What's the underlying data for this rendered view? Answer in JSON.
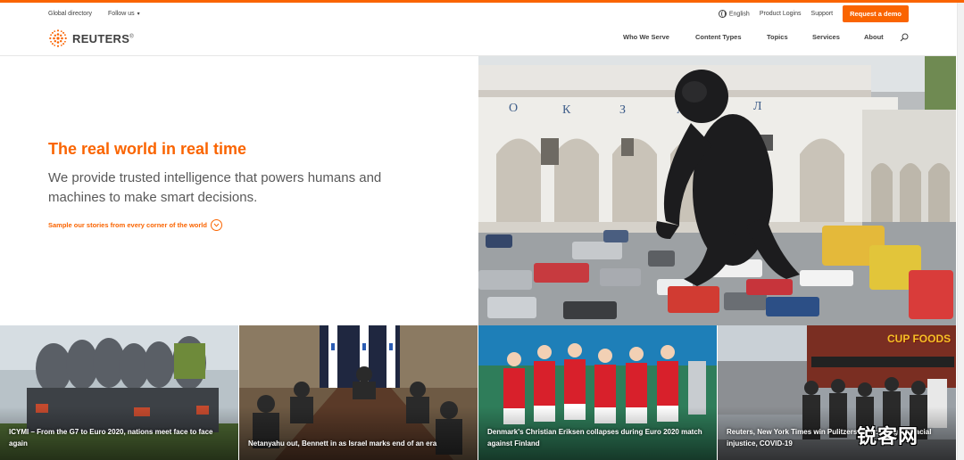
{
  "utility_nav": {
    "global_directory": "Global directory",
    "follow_us": "Follow us",
    "language": "English",
    "product_logins": "Product Logins",
    "support": "Support",
    "request_demo": "Request a demo"
  },
  "brand": {
    "name": "REUTERS",
    "reg": "®",
    "accent": "#fa6400"
  },
  "main_nav": [
    "Who We Serve",
    "Content Types",
    "Topics",
    "Services",
    "About"
  ],
  "icons": {
    "search": "search-icon",
    "globe": "globe-icon",
    "chevron": "chevron-down-icon"
  },
  "hero": {
    "title": "The real world in real time",
    "subtitle": "We provide trusted intelligence that powers humans and machines to make smart decisions.",
    "sample_link": "Sample our stories from every corner of the world"
  },
  "stories": [
    {
      "caption": "ICYMI – From the G7 to Euro 2020, nations meet face to face again"
    },
    {
      "caption": "Netanyahu out, Bennett in as Israel marks end of an era"
    },
    {
      "caption": "Denmark's Christian Eriksen collapses during Euro 2020 match against Finland"
    },
    {
      "caption": "Reuters, New York Times win Pulitzers for coverage of racial injustice, COVID-19"
    }
  ],
  "storefront_sign": "CUP FOODS",
  "watermark": "锐客网"
}
